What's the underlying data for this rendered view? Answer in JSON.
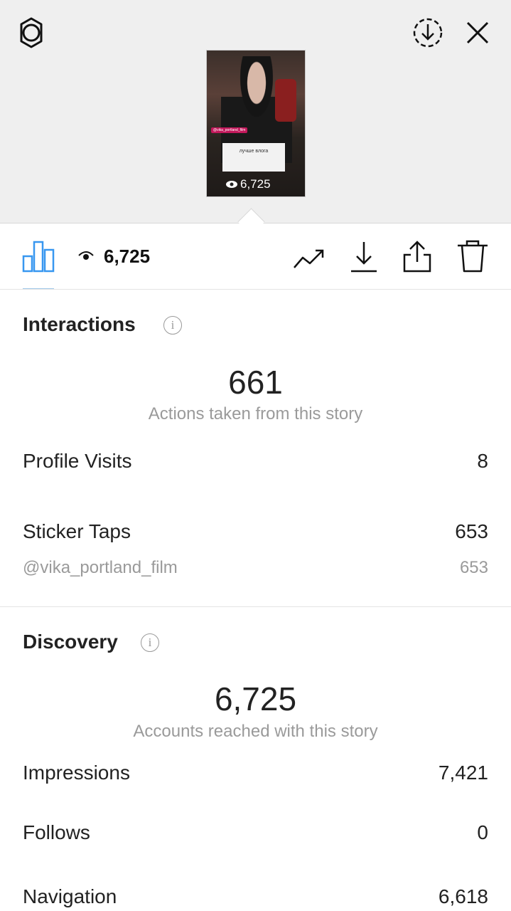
{
  "story_preview": {
    "username_tag": "@vika_portland_film",
    "sticker_text": "лучше влога",
    "views": "6,725"
  },
  "toolbar": {
    "views": "6,725"
  },
  "interactions": {
    "title": "Interactions",
    "total": "661",
    "caption": "Actions taken from this story",
    "rows": [
      {
        "label": "Profile Visits",
        "value": "8"
      },
      {
        "label": "Sticker Taps",
        "value": "653"
      }
    ],
    "sub_rows": [
      {
        "label": "@vika_portland_film",
        "value": "653"
      }
    ]
  },
  "discovery": {
    "title": "Discovery",
    "total": "6,725",
    "caption": "Accounts reached with this story",
    "rows": [
      {
        "label": "Impressions",
        "value": "7,421"
      },
      {
        "label": "Follows",
        "value": "0"
      },
      {
        "label": "Navigation",
        "value": "6,618"
      }
    ]
  },
  "colors": {
    "accent": "#3897f0",
    "top_background": "#efefef"
  },
  "icons": [
    "settings-icon",
    "download-circle-icon",
    "close-icon",
    "insights-icon",
    "eye-icon",
    "promote-icon",
    "download-icon",
    "share-icon",
    "delete-icon",
    "info-icon"
  ]
}
